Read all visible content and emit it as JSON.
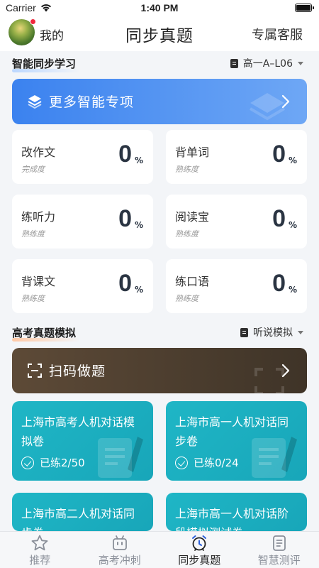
{
  "status": {
    "carrier": "Carrier",
    "time": "1:40 PM"
  },
  "nav": {
    "my_label": "我的",
    "title": "同步真题",
    "service": "专属客服"
  },
  "sync": {
    "title": "智能同步学习",
    "select": "高一A–L06",
    "banner": "更多智能专项",
    "cards": [
      {
        "name": "改作文",
        "sub": "完成度",
        "value": "0",
        "unit": "%"
      },
      {
        "name": "背单词",
        "sub": "熟练度",
        "value": "0",
        "unit": "%"
      },
      {
        "name": "练听力",
        "sub": "熟练度",
        "value": "0",
        "unit": "%"
      },
      {
        "name": "阅读宝",
        "sub": "熟练度",
        "value": "0",
        "unit": "%"
      },
      {
        "name": "背课文",
        "sub": "熟练度",
        "value": "0",
        "unit": "%"
      },
      {
        "name": "练口语",
        "sub": "熟练度",
        "value": "0",
        "unit": "%"
      }
    ]
  },
  "exam": {
    "title": "高考真题模拟",
    "select": "听说模拟",
    "banner": "扫码做题",
    "papers": [
      {
        "title": "上海市高考人机对话模拟卷",
        "progress": "已练2/50"
      },
      {
        "title": "上海市高一人机对话同步卷",
        "progress": "已练0/24"
      },
      {
        "title": "上海市高二人机对话同步卷",
        "progress": ""
      },
      {
        "title": "上海市高一人机对话阶段模拟测试卷",
        "progress": ""
      }
    ]
  },
  "tabs": [
    {
      "label": "推荐",
      "icon": "star-icon"
    },
    {
      "label": "高考冲刺",
      "icon": "robot-icon"
    },
    {
      "label": "同步真题",
      "icon": "alarm-clock-icon",
      "active": true
    },
    {
      "label": "智慧测评",
      "icon": "clipboard-icon"
    }
  ],
  "colors": {
    "accent_blue": "#3b82ef",
    "teal": "#1fb6c6",
    "brown": "#5d4a37",
    "active_tab": "#2b5fd9"
  }
}
